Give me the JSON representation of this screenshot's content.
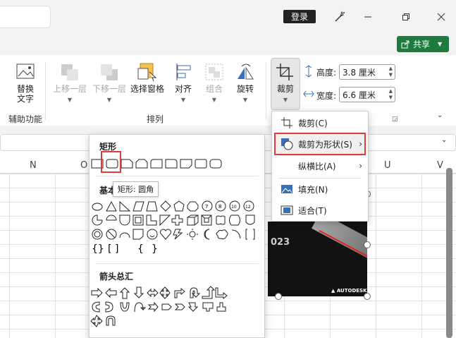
{
  "title_bar": {
    "login": "登录"
  },
  "share": {
    "label": "共享"
  },
  "ribbon": {
    "alt_text": {
      "label_line1": "替换",
      "label_line2": "文字",
      "group": "辅助功能"
    },
    "bring_forward": "上移一层",
    "send_backward": "下移一层",
    "selection_pane": "选择窗格",
    "align": "对齐",
    "group": "组合",
    "rotate": "旋转",
    "arrange_group": "排列",
    "crop": "裁剪",
    "height_label": "高度:",
    "height_value": "3.8 厘米",
    "width_label": "宽度:",
    "width_value": "6.6 厘米"
  },
  "columns": [
    "N",
    "O",
    "U",
    "V"
  ],
  "picture": {
    "text_year": "023",
    "brand": "AUTODESK"
  },
  "shape_gallery": {
    "section_rect": "矩形",
    "section_basic": "基本",
    "section_arrows": "箭头总汇",
    "tooltip": "矩形: 圆角"
  },
  "crop_menu": {
    "items": [
      {
        "label": "裁剪(C)",
        "icon": "crop-icon"
      },
      {
        "label": "裁剪为形状(S)",
        "icon": "crop-to-shape-icon"
      },
      {
        "label": "纵横比(A)",
        "icon": ""
      },
      {
        "label": "填充(N)",
        "icon": "fill-icon"
      },
      {
        "label": "适合(T)",
        "icon": "fit-icon"
      }
    ]
  },
  "colors": {
    "accent_green": "#1f7a3d",
    "highlight_red": "#e13a3a"
  }
}
